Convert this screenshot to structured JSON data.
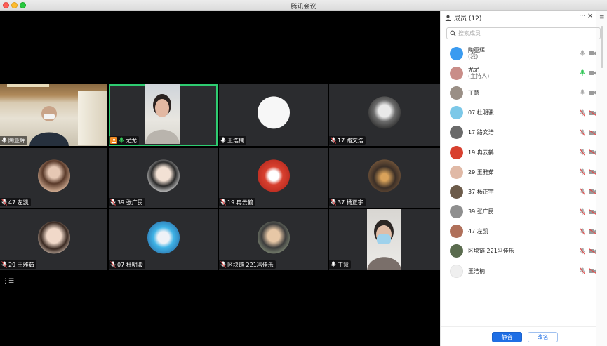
{
  "window": {
    "title": "腾讯会议"
  },
  "stage": {
    "tiles": [
      {
        "name": "陶亚辉",
        "mic": "on"
      },
      {
        "name": "尤尤",
        "mic": "on-active",
        "host": true,
        "active": true
      },
      {
        "name": "王浩楠",
        "mic": "on"
      },
      {
        "name": "17 路文浩",
        "mic": "muted"
      },
      {
        "name": "47 左凯",
        "mic": "muted"
      },
      {
        "name": "39 张广民",
        "mic": "muted"
      },
      {
        "name": "19 冉云鹤",
        "mic": "muted"
      },
      {
        "name": "37 杨正宇",
        "mic": "muted"
      },
      {
        "name": "29 王雅茹",
        "mic": "muted"
      },
      {
        "name": "07 杜明骏",
        "mic": "muted"
      },
      {
        "name": "区块链 221冯佳乐",
        "mic": "muted"
      },
      {
        "name": "丁慧",
        "mic": "on"
      }
    ],
    "toolbar_glyph": "⋮☰"
  },
  "panel": {
    "title": "成员 (12)",
    "more_icon": "···",
    "close_icon": "✕",
    "menu_icon": "≡",
    "search_placeholder": "搜索成员",
    "members": [
      {
        "name": "陶亚辉",
        "role": "(我)",
        "mic": "on",
        "color": "#3a9bf0"
      },
      {
        "name": "尤尤",
        "role": "(主持人)",
        "mic": "active",
        "color": "#c98d88"
      },
      {
        "name": "丁慧",
        "role": "",
        "mic": "on",
        "color": "#9a8f86"
      },
      {
        "name": "07 杜明骏",
        "role": "",
        "mic": "muted",
        "color": "#7cc8e8"
      },
      {
        "name": "17 路文浩",
        "role": "",
        "mic": "muted",
        "color": "#6a6a6a"
      },
      {
        "name": "19 冉云鹤",
        "role": "",
        "mic": "muted",
        "color": "#d8402f"
      },
      {
        "name": "29 王雅茹",
        "role": "",
        "mic": "muted",
        "color": "#e0b9a6"
      },
      {
        "name": "37 杨正宇",
        "role": "",
        "mic": "muted",
        "color": "#6c5b4a"
      },
      {
        "name": "39 张广民",
        "role": "",
        "mic": "muted",
        "color": "#8f8f8f"
      },
      {
        "name": "47 左凯",
        "role": "",
        "mic": "muted",
        "color": "#b0705a"
      },
      {
        "name": "区块链 221冯佳乐",
        "role": "",
        "mic": "muted",
        "color": "#5a6b4e"
      },
      {
        "name": "王浩楠",
        "role": "",
        "mic": "muted",
        "color": "#efefef"
      }
    ],
    "mute_button": "静音",
    "rename_button": "改名"
  },
  "colors": {
    "accent": "#1f6fe5",
    "active_border": "#2ecc71",
    "muted_red": "#e04848",
    "speaking_green": "#34c759"
  }
}
